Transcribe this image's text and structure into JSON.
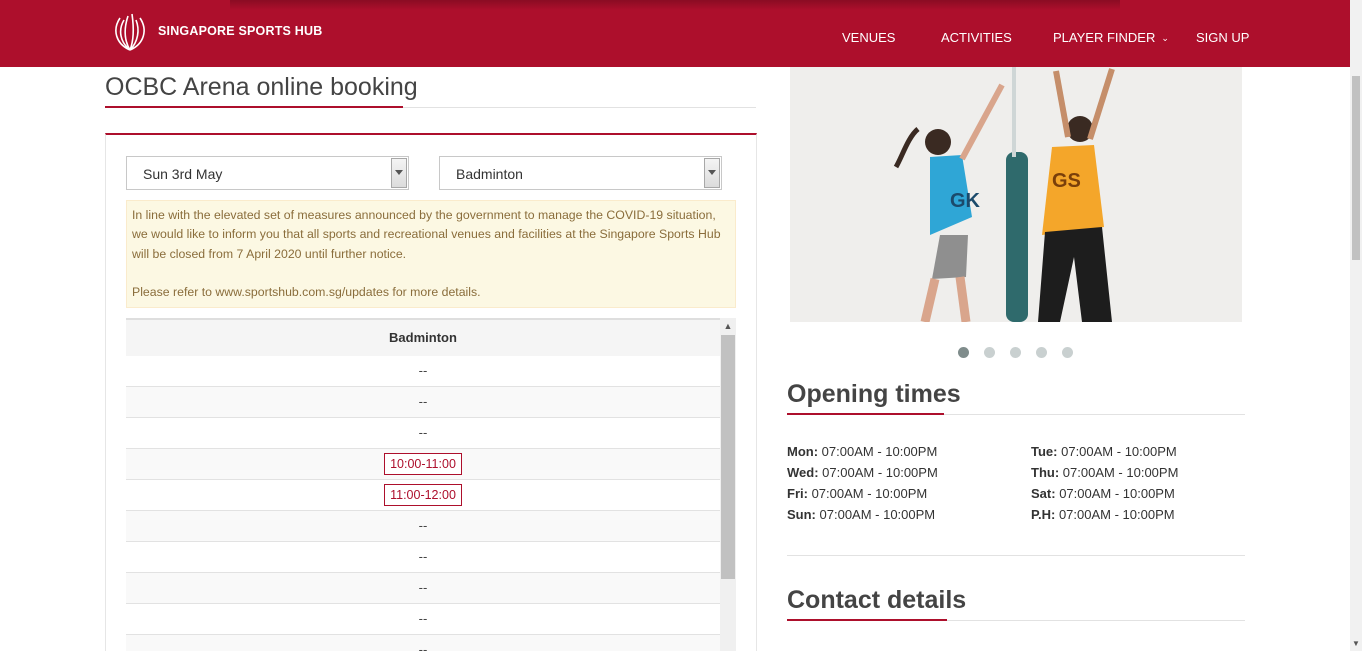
{
  "header": {
    "brand": "SINGAPORE SPORTS HUB",
    "nav": {
      "venues": "VENUES",
      "activities": "ACTIVITIES",
      "player_finder": "PLAYER FINDER",
      "sign_up": "SIGN UP"
    }
  },
  "booking": {
    "title": "OCBC Arena online booking",
    "date_select": "Sun 3rd May",
    "sport_select": "Badminton",
    "notice": {
      "line1": "In line with the elevated set of measures announced by the government to manage the COVID-19 situation, we would like to inform you that all sports and recreational venues and facilities at the Singapore Sports Hub will be closed from 7 April 2020 until further notice.",
      "line2": "Please refer to www.sportshub.com.sg/updates for more details."
    },
    "table": {
      "header": "Badminton",
      "rows": [
        "--",
        "--",
        "--",
        "10:00-11:00",
        "11:00-12:00",
        "--",
        "--",
        "--",
        "--",
        "--"
      ]
    }
  },
  "carousel": {
    "slide_count": 5,
    "active_index": 0
  },
  "opening_times": {
    "title": "Opening times",
    "left": [
      {
        "day": "Mon:",
        "hours": "07:00AM - 10:00PM"
      },
      {
        "day": "Wed:",
        "hours": "07:00AM - 10:00PM"
      },
      {
        "day": "Fri:",
        "hours": "07:00AM - 10:00PM"
      },
      {
        "day": "Sun:",
        "hours": "07:00AM - 10:00PM"
      }
    ],
    "right": [
      {
        "day": "Tue:",
        "hours": "07:00AM - 10:00PM"
      },
      {
        "day": "Thu:",
        "hours": "07:00AM - 10:00PM"
      },
      {
        "day": "Sat:",
        "hours": "07:00AM - 10:00PM"
      },
      {
        "day": "P.H:",
        "hours": "07:00AM - 10:00PM"
      }
    ]
  },
  "contact": {
    "title": "Contact details"
  },
  "colors": {
    "brand": "#ad0f2c",
    "notice_bg": "#fcf8e3",
    "notice_text": "#8a6d3b"
  }
}
